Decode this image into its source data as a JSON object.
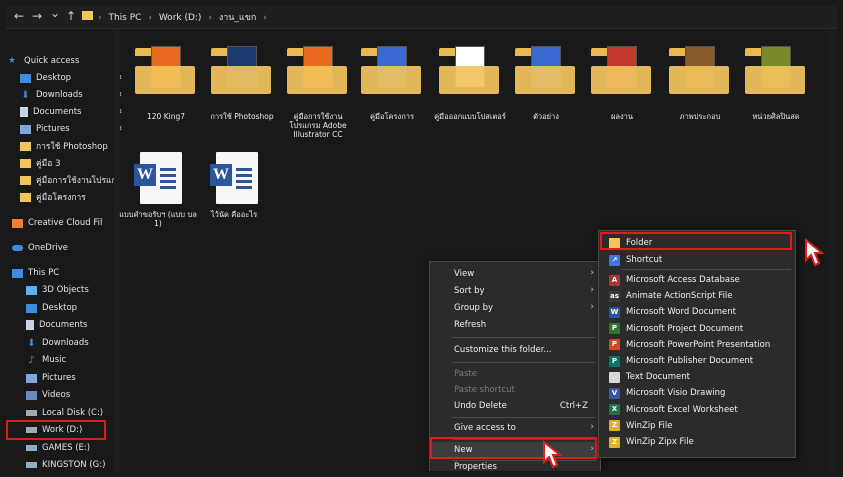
{
  "nav": {
    "back_icon": "←",
    "forward_icon": "→",
    "down_icon": "⌄",
    "up_icon": "↑"
  },
  "breadcrumb": [
    "This PC",
    "Work (D:)",
    "งาน_แขก"
  ],
  "sidebar": {
    "quick_access": "Quick access",
    "quick_items": [
      "Desktop",
      "Downloads",
      "Documents",
      "Pictures",
      "การใช้ Photoshop",
      "คู่มือ 3",
      "คู่มือการใช้งานโปรแกรม",
      "คู่มือโครงการ"
    ],
    "creative_cloud": "Creative Cloud Fil",
    "onedrive": "OneDrive",
    "this_pc": "This PC",
    "pc_items": [
      "3D Objects",
      "Desktop",
      "Documents",
      "Downloads",
      "Music",
      "Pictures",
      "Videos",
      "Local Disk (C:)",
      "Work (D:)",
      "GAMES (E:)",
      "KINGSTON (G:)"
    ]
  },
  "files": [
    {
      "label": "120 King7",
      "kind": "folder",
      "accent": "#e86a1e"
    },
    {
      "label": "การใช้ Photoshop",
      "kind": "folder",
      "accent": "#1c3a6e"
    },
    {
      "label": "คู่มือการใช้งานโปรแกรม Adobe Illustrator CC",
      "kind": "folder",
      "accent": "#e86a1e"
    },
    {
      "label": "คู่มือโครงการ",
      "kind": "folder",
      "accent": "#3a6ad1"
    },
    {
      "label": "คู่มือออกแบบโปสเตอร์",
      "kind": "folder",
      "accent": "#ffffff"
    },
    {
      "label": "ตัวอย่าง",
      "kind": "folder",
      "accent": "#3a6ad1"
    },
    {
      "label": "ผลงาน",
      "kind": "folder",
      "accent": "#c0392b"
    },
    {
      "label": "ภาพประกอบ",
      "kind": "folder",
      "accent": "#8b5a2b"
    },
    {
      "label": "หน่วยศิลปินสด",
      "kind": "folder",
      "accent": "#7a8a2b"
    },
    {
      "label": "แบบคำขอรับฯ (แบบ บล 1)",
      "kind": "word"
    },
    {
      "label": "ไว้นัด คืออะไร",
      "kind": "word"
    }
  ],
  "context_menu": {
    "items": [
      {
        "label": "View",
        "has_submenu": true,
        "disabled": false
      },
      {
        "label": "Sort by",
        "has_submenu": true,
        "disabled": false
      },
      {
        "label": "Group by",
        "has_submenu": true,
        "disabled": false
      },
      {
        "label": "Refresh",
        "has_submenu": false,
        "disabled": false
      },
      {
        "label": "Customize this folder...",
        "has_submenu": false,
        "disabled": false
      },
      {
        "label": "Paste",
        "has_submenu": false,
        "disabled": true
      },
      {
        "label": "Paste shortcut",
        "has_submenu": false,
        "disabled": true
      },
      {
        "label": "Undo Delete",
        "has_submenu": false,
        "disabled": false,
        "shortcut": "Ctrl+Z"
      },
      {
        "label": "Give access to",
        "has_submenu": true,
        "disabled": false
      },
      {
        "label": "New",
        "has_submenu": true,
        "disabled": false
      },
      {
        "label": "Properties",
        "has_submenu": false,
        "disabled": false
      }
    ],
    "arrow_glyph": "›"
  },
  "new_submenu": {
    "items": [
      {
        "label": "Folder",
        "icon": "folder-icon",
        "color": "#f2c45c",
        "glyph": ""
      },
      {
        "label": "Shortcut",
        "icon": "shortcut-icon",
        "color": "#3b78d8",
        "glyph": "↗"
      },
      {
        "label": "Microsoft Access Database",
        "icon": "access-icon",
        "color": "#a4373a",
        "glyph": "A"
      },
      {
        "label": "Animate ActionScript File",
        "icon": "animate-icon",
        "color": "#3a3a3a",
        "glyph": "as"
      },
      {
        "label": "Microsoft Word Document",
        "icon": "word-icon",
        "color": "#2b579a",
        "glyph": "W"
      },
      {
        "label": "Microsoft Project Document",
        "icon": "project-icon",
        "color": "#31752f",
        "glyph": "P"
      },
      {
        "label": "Microsoft PowerPoint Presentation",
        "icon": "powerpoint-icon",
        "color": "#d24726",
        "glyph": "P"
      },
      {
        "label": "Microsoft Publisher Document",
        "icon": "publisher-icon",
        "color": "#077568",
        "glyph": "P"
      },
      {
        "label": "Text Document",
        "icon": "text-icon",
        "color": "#d8d8d8",
        "glyph": ""
      },
      {
        "label": "Microsoft Visio Drawing",
        "icon": "visio-icon",
        "color": "#3955a3",
        "glyph": "V"
      },
      {
        "label": "Microsoft Excel Worksheet",
        "icon": "excel-icon",
        "color": "#217346",
        "glyph": "X"
      },
      {
        "label": "WinZip File",
        "icon": "winzip-icon",
        "color": "#e0b020",
        "glyph": "Z"
      },
      {
        "label": "WinZip Zipx File",
        "icon": "winzipx-icon",
        "color": "#e0b020",
        "glyph": "Z"
      }
    ]
  },
  "colors": {
    "highlight": "#e21b1b",
    "accent": "#0078d7"
  }
}
